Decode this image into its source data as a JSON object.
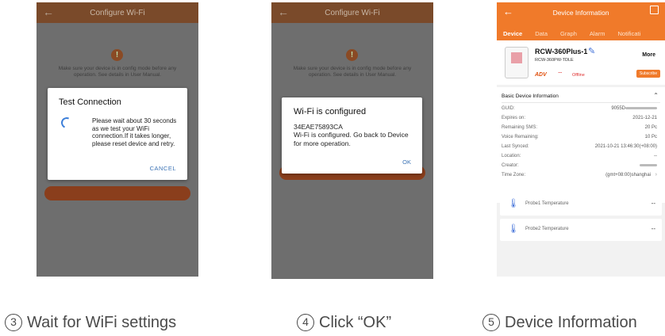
{
  "screen1": {
    "header_title": "Configure Wi-Fi",
    "dim_text": "Make sure your device is in config mode before any operation. See details in User Manual.",
    "dialog": {
      "title": "Test Connection",
      "message": "Please wait about 30 seconds as we test your WiFi connection.If it takes longer, please reset device and retry.",
      "action": "CANCEL"
    }
  },
  "screen2": {
    "header_title": "Configure Wi-Fi",
    "dim_text": "Make sure your device is in config mode before any operation. See details in User Manual.",
    "dialog": {
      "title": "Wi-Fi is configured",
      "ssid": "34EAE75893CA",
      "message": "Wi-Fi is configured. Go back to Device for more operation.",
      "action": "OK"
    }
  },
  "screen3": {
    "header_title": "Device Information",
    "tabs": [
      "Device",
      "Data",
      "Graph",
      "Alarm",
      "Notificati"
    ],
    "device": {
      "name": "RCW-360Plus-1",
      "model": "RCW-360PW-TDLE",
      "badge": "ADV",
      "status": "Offline",
      "more": "More",
      "subscribe": "Subscribe"
    },
    "info": {
      "section": "Basic Device Information",
      "rows": [
        {
          "k": "GUID:",
          "v": "9055D"
        },
        {
          "k": "Expires on:",
          "v": "2021-12-21"
        },
        {
          "k": "Remaining SMS:",
          "v": "20 Pc"
        },
        {
          "k": "Voice Remaining:",
          "v": "10 Pc"
        },
        {
          "k": "Last Synced:",
          "v": "2021-10-21 13:46:30(+08:00)"
        },
        {
          "k": "Location:",
          "v": "--"
        },
        {
          "k": "Creator:",
          "v": ""
        },
        {
          "k": "Time Zone:",
          "v": "(gmt+08:00)shanghai"
        }
      ]
    },
    "probes": [
      {
        "label": "Probe1 Temperature",
        "value": "--"
      },
      {
        "label": "Probe2 Temperature",
        "value": "--"
      }
    ]
  },
  "captions": [
    {
      "num": "3",
      "text": "Wait for WiFi settings"
    },
    {
      "num": "4",
      "text": "Click “OK”"
    },
    {
      "num": "5",
      "text": "Device Information"
    }
  ],
  "colors": {
    "accent": "#f07a2a",
    "link": "#3d74b6"
  }
}
